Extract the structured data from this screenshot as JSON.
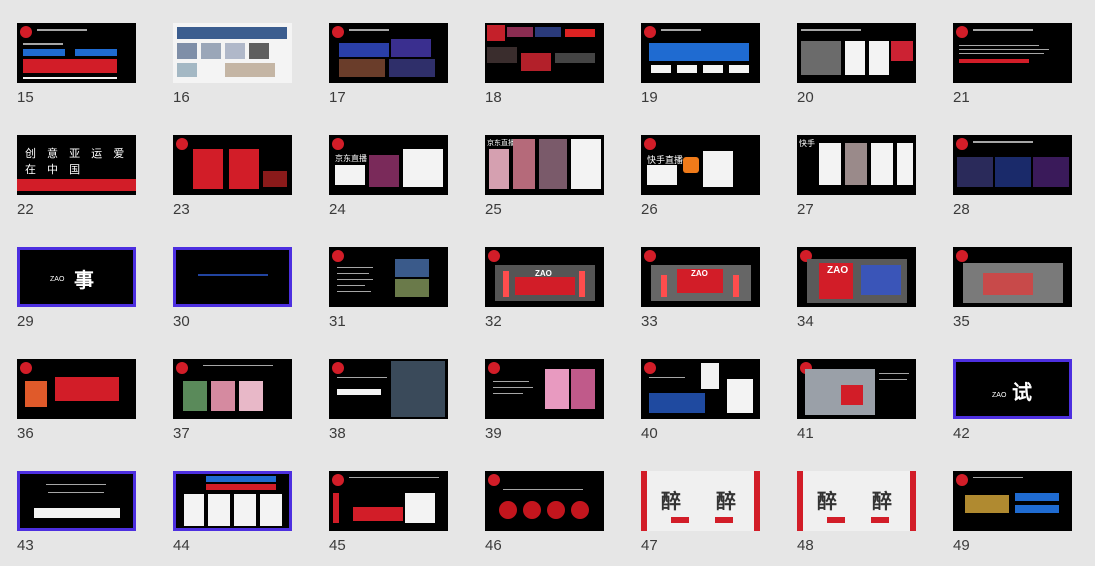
{
  "slides": [
    {
      "number": "15",
      "thumb_char": ""
    },
    {
      "number": "16",
      "thumb_char": ""
    },
    {
      "number": "17",
      "thumb_char": ""
    },
    {
      "number": "18",
      "thumb_char": ""
    },
    {
      "number": "19",
      "thumb_char": ""
    },
    {
      "number": "20",
      "thumb_char": ""
    },
    {
      "number": "21",
      "thumb_char": ""
    },
    {
      "number": "22",
      "thumb_char": "创 意 亚 运 爱 在 中 国"
    },
    {
      "number": "23",
      "thumb_char": ""
    },
    {
      "number": "24",
      "thumb_char": "京东直播"
    },
    {
      "number": "25",
      "thumb_char": "京东直播"
    },
    {
      "number": "26",
      "thumb_char": "快手直播"
    },
    {
      "number": "27",
      "thumb_char": "快手"
    },
    {
      "number": "28",
      "thumb_char": ""
    },
    {
      "number": "29",
      "thumb_char": "事"
    },
    {
      "number": "30",
      "thumb_char": ""
    },
    {
      "number": "31",
      "thumb_char": ""
    },
    {
      "number": "32",
      "thumb_char": "ZAO"
    },
    {
      "number": "33",
      "thumb_char": "ZAO"
    },
    {
      "number": "34",
      "thumb_char": "ZAO"
    },
    {
      "number": "35",
      "thumb_char": ""
    },
    {
      "number": "36",
      "thumb_char": ""
    },
    {
      "number": "37",
      "thumb_char": ""
    },
    {
      "number": "38",
      "thumb_char": ""
    },
    {
      "number": "39",
      "thumb_char": ""
    },
    {
      "number": "40",
      "thumb_char": ""
    },
    {
      "number": "41",
      "thumb_char": ""
    },
    {
      "number": "42",
      "thumb_char": "试"
    },
    {
      "number": "43",
      "thumb_char": ""
    },
    {
      "number": "44",
      "thumb_char": ""
    },
    {
      "number": "45",
      "thumb_char": ""
    },
    {
      "number": "46",
      "thumb_char": ""
    },
    {
      "number": "47",
      "thumb_char": "醉 醉"
    },
    {
      "number": "48",
      "thumb_char": "醉 醉"
    },
    {
      "number": "49",
      "thumb_char": ""
    }
  ],
  "brand_text": "ZAO",
  "colors": {
    "background": "#e6e6e6",
    "thumb_bg": "#000000",
    "accent_red": "#d21d28",
    "accent_blue": "#1f6bd1",
    "frame_purple": "#4d2fe0"
  }
}
